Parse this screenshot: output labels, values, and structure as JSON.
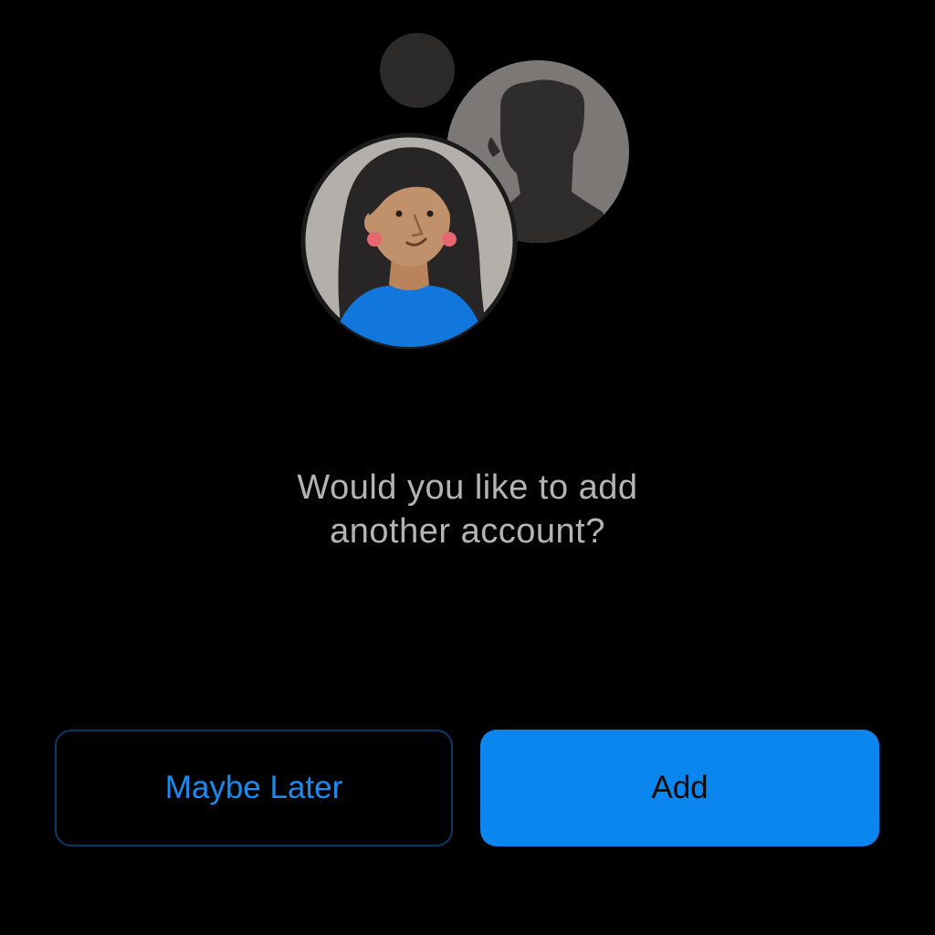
{
  "prompt": {
    "line1": "Would you like to add",
    "line2": "another account?"
  },
  "actions": {
    "secondary_label": "Maybe Later",
    "primary_label": "Add"
  },
  "illustration": {
    "icons": [
      "small-dot-icon",
      "silhouette-avatar-icon",
      "woman-avatar-icon"
    ]
  },
  "colors": {
    "background": "#000000",
    "accent": "#0a86ee",
    "secondary_text": "#1a8cf0",
    "prompt_text": "#b4b4b4"
  }
}
